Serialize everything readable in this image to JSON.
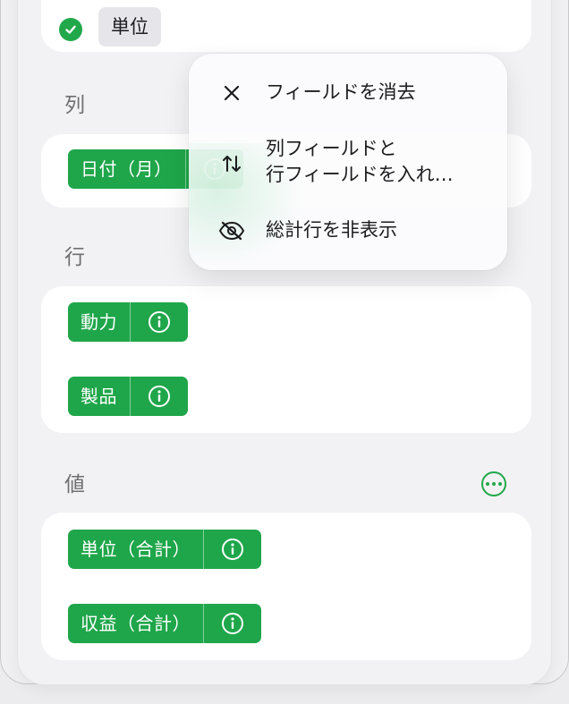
{
  "top_card": {
    "chip_label": "単位"
  },
  "columns": {
    "label": "列",
    "fields": [
      {
        "label": "日付（月）"
      }
    ]
  },
  "rows": {
    "label": "行",
    "fields": [
      {
        "label": "動力"
      },
      {
        "label": "製品"
      }
    ]
  },
  "values": {
    "label": "値",
    "fields": [
      {
        "label": "単位（合計）"
      },
      {
        "label": "収益（合計）"
      }
    ]
  },
  "context_menu": {
    "items": [
      {
        "label": "フィールドを消去",
        "icon": "close-icon"
      },
      {
        "label_line1": "列フィールドと",
        "label_line2": "行フィールドを入れ…",
        "icon": "swap-arrows-icon"
      },
      {
        "label": "総計行を非表示",
        "icon": "eye-slash-icon"
      }
    ]
  },
  "colors": {
    "accent": "#1fa64a",
    "menu_text": "#1c1c1e",
    "section_label": "#6e6e73"
  }
}
